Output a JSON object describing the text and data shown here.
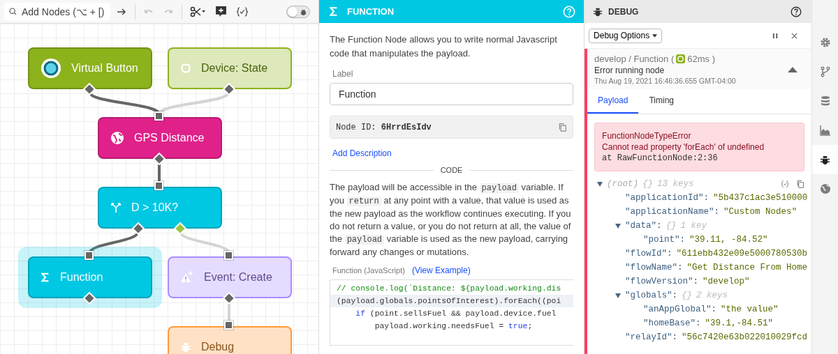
{
  "toolbar": {
    "search": {
      "placeholder": "Add Nodes (⌥ + [)"
    },
    "undo": {
      "disabled": true
    },
    "redo": {
      "disabled": true
    },
    "debug_toggle": {
      "on": false
    }
  },
  "canvas": {
    "nodes": [
      {
        "label": "Virtual Button",
        "kind": "button",
        "color": "#8cb21c",
        "faded": false,
        "selected": false
      },
      {
        "label": "Device: State",
        "kind": "device",
        "color": "#8cb21c",
        "faded": true,
        "selected": false
      },
      {
        "label": "GPS Distance",
        "kind": "geo",
        "color": "#e0218a",
        "faded": false,
        "selected": false
      },
      {
        "label": "D > 10K?",
        "kind": "condition",
        "color": "#00c8e3",
        "faded": false,
        "selected": false
      },
      {
        "label": "Function",
        "kind": "function",
        "color": "#00c8e3",
        "faded": false,
        "selected": true
      },
      {
        "label": "Event: Create",
        "kind": "event",
        "color": "#a98bff",
        "faded": true,
        "selected": false
      },
      {
        "label": "Debug",
        "kind": "debug",
        "color": "#ff9a3c",
        "faded": true,
        "selected": false
      }
    ]
  },
  "function_panel": {
    "title": "FUNCTION",
    "description": "The Function Node allows you to write normal Javascript code that manipulates the payload.",
    "label_field": {
      "label": "Label",
      "value": "Function"
    },
    "node_id": {
      "prefix": "Node ID:",
      "value": "6HrrdEsIdv"
    },
    "add_description": "Add Description",
    "section": "CODE",
    "help": [
      {
        "text": "The payload will be accessible in the ",
        "kind": "text"
      },
      {
        "text": "payload",
        "kind": "code"
      },
      {
        "text": " variable. If you ",
        "kind": "text"
      },
      {
        "text": "return",
        "kind": "code"
      },
      {
        "text": " at any point with a value, that value is used as the new payload as the workflow continues executing. If you do not return a value, or you do not return at all, the value of the ",
        "kind": "text"
      },
      {
        "text": "payload",
        "kind": "code"
      },
      {
        "text": " variable is used as the new payload, carrying forward any changes or mutations.",
        "kind": "text"
      }
    ],
    "code_label": "Function (JavaScript)",
    "view_example": "(View Example)",
    "code_lines": [
      {
        "active": false,
        "tokens": [
          {
            "text": "// console.log(`Distance: ${payload.working.dis",
            "kind": "comment"
          }
        ]
      },
      {
        "active": true,
        "tokens": [
          {
            "text": "(payload.globals.pointsOfInterest).forEach((poi",
            "kind": "plain"
          }
        ]
      },
      {
        "active": false,
        "tokens": [
          {
            "text": "    if",
            "kind": "keyword"
          },
          {
            "text": " (point.sellsFuel && payload.device.fuel",
            "kind": "plain"
          }
        ]
      },
      {
        "active": false,
        "tokens": [
          {
            "text": "        payload.working.needsFuel = ",
            "kind": "plain"
          },
          {
            "text": "true",
            "kind": "keyword"
          },
          {
            "text": ";",
            "kind": "plain"
          }
        ]
      }
    ]
  },
  "debug_panel": {
    "title": "DEBUG",
    "options_button": "Debug Options",
    "entry": {
      "path": "develop / Function (",
      "duration": "62ms )",
      "message": "Error running node",
      "timestamp": "Thu Aug 19, 2021 16:46:36.655 GMT-04:00",
      "expanded": true,
      "tabs": [
        {
          "label": "Payload",
          "selected": true
        },
        {
          "label": "Timing",
          "selected": false
        }
      ],
      "error": {
        "name": "FunctionNodeTypeError",
        "message": "Cannot read property 'forEach' of undefined",
        "location": "at RawFunctionNode:2:36"
      },
      "tree": {
        "key": "(root)",
        "type": "{}",
        "count": "13 keys",
        "expanded": true,
        "children": [
          {
            "key": "\"applicationId\":",
            "value": "\"5b437c1ac3e510000"
          },
          {
            "key": "\"applicationName\":",
            "value": "\"Custom Nodes\""
          },
          {
            "key": "\"data\":",
            "type": "{}",
            "count": "1 key",
            "expanded": true,
            "children": [
              {
                "key": "\"point\":",
                "value": "\"39.11, -84.52\""
              }
            ]
          },
          {
            "key": "\"flowId\":",
            "value": "\"611ebb432e09e5000780530b"
          },
          {
            "key": "\"flowName\":",
            "value": "\"Get Distance From Home"
          },
          {
            "key": "\"flowVersion\":",
            "value": "\"develop\""
          },
          {
            "key": "\"globals\":",
            "type": "{}",
            "count": "2 keys",
            "expanded": true,
            "children": [
              {
                "key": "\"anAppGlobal\":",
                "value": "\"the value\""
              },
              {
                "key": "\"homeBase\":",
                "value": "\"39.1,-84.51\""
              }
            ]
          },
          {
            "key": "\"relayId\":",
            "value": "\"56c7420e63b022010029fcd"
          }
        ]
      }
    }
  },
  "side_rail": [
    {
      "kind": "settings",
      "selected": false
    },
    {
      "kind": "branch",
      "selected": false
    },
    {
      "kind": "database",
      "selected": false
    },
    {
      "kind": "chart",
      "selected": false
    },
    {
      "kind": "debug",
      "selected": true
    },
    {
      "kind": "globe",
      "selected": false
    }
  ]
}
